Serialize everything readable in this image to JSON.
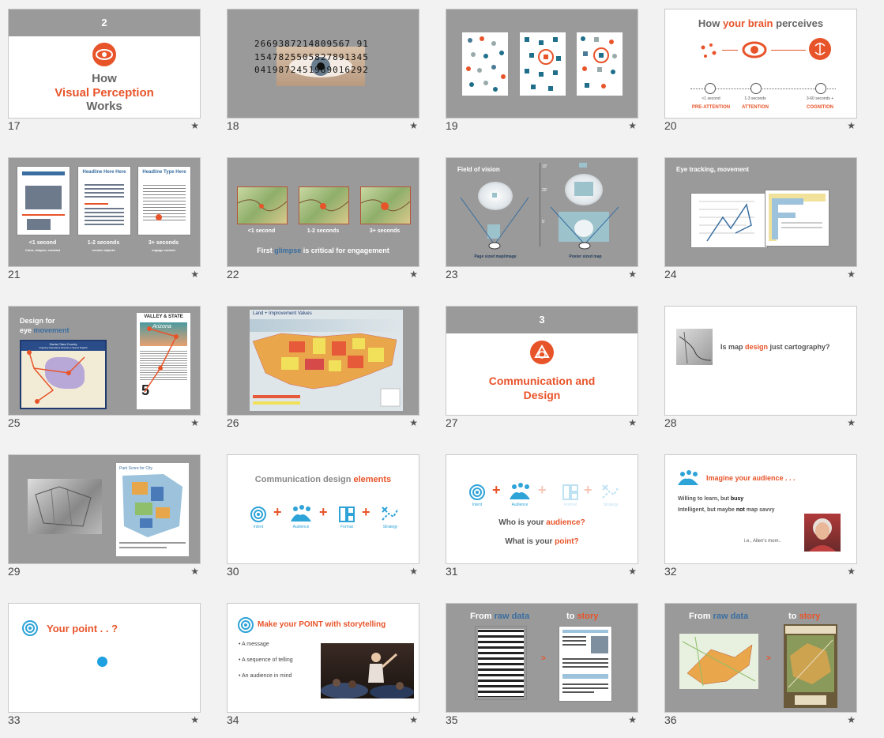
{
  "colors": {
    "accent": "#e8542a",
    "blue": "#2ea3d8",
    "grey": "#9a9a9a",
    "dark": "#555555"
  },
  "star": "★",
  "slides": {
    "s17": {
      "num": "17",
      "section": "2",
      "l1": "How",
      "l2": "Visual Perception",
      "l3": "Works"
    },
    "s18": {
      "num": "18",
      "r1": "2669387214809567 91",
      "r2": "1547825505827891345",
      "r3": "0419872451989016292"
    },
    "s19": {
      "num": "19"
    },
    "s20": {
      "num": "20",
      "t1": "How ",
      "t2": "your brain",
      "t3": " perceives",
      "a1": "<1 second",
      "a2": "1-3 seconds",
      "a3": "3-60 seconds +",
      "b1": "PRE-ATTENTION",
      "b2": "ATTENTION",
      "b3": "COGNITION"
    },
    "s21": {
      "num": "21",
      "h1": "Headline Here Here",
      "h2": "Headline Type Here",
      "c1": "<1 second",
      "c2": "1-2 seconds",
      "c3": "3+ seconds",
      "d1": "Color, shapes, contrast",
      "d2": "resolve objects",
      "d3": "engage content"
    },
    "s22": {
      "num": "22",
      "c1": "<1 second",
      "c2": "1-2 seconds",
      "c3": "3+ seconds",
      "m1": "First ",
      "m2": "glimpse",
      "m3": " is critical for engagement"
    },
    "s23": {
      "num": "23",
      "title": "Field of vision",
      "l1": "Page sized map/image",
      "l2": "Poster sized map",
      "d1": "10'",
      "d2": "20'",
      "d3": "5'"
    },
    "s24": {
      "num": "24",
      "title": "Eye tracking, movement"
    },
    "s25": {
      "num": "25",
      "t1": "Design for",
      "t2": "eye ",
      "t3": "movement",
      "m1": "Santa Clara County",
      "m2": "Ongoing Operations Directly to Spend English",
      "m3": "VALLEY & STATE",
      "m4": "Arizona",
      "big": "5"
    },
    "s26": {
      "num": "26",
      "title": "Land + Improvement Values"
    },
    "s27": {
      "num": "27",
      "section": "3",
      "l1": "Communication and",
      "l2": "Design"
    },
    "s28": {
      "num": "28",
      "t1": "Is map ",
      "t2": "design",
      "t3": " just cartography?"
    },
    "s29": {
      "num": "29",
      "title": "Park Score for City"
    },
    "s30": {
      "num": "30",
      "t1": "Communication design ",
      "t2": "elements",
      "plus": "+",
      "i1": "Intent",
      "i2": "Audience",
      "i3": "Format",
      "i4": "Strategy"
    },
    "s31": {
      "num": "31",
      "plus": "+",
      "i1": "Intent",
      "i2": "Audience",
      "i3": "Format",
      "i4": "Strategy",
      "q1a": "Who is your ",
      "q1b": "audience?",
      "q2a": "What is your ",
      "q2b": "point?"
    },
    "s32": {
      "num": "32",
      "title": "Imagine your audience . . .",
      "l1a": "Willing to learn, but ",
      "l1b": "busy",
      "l2a": "Intelligent, but maybe ",
      "l2b": "not",
      "l2c": " map savvy",
      "cap": "i.e., Allen's mom.."
    },
    "s33": {
      "num": "33",
      "title": "Your point . . ?"
    },
    "s34": {
      "num": "34",
      "title": "Make your POINT with storytelling",
      "b1": "A message",
      "b2": "A sequence of telling",
      "b3": "An audience in mind"
    },
    "s35": {
      "num": "35",
      "t1": "From ",
      "t2": "raw data",
      "t3": "to ",
      "t4": "story",
      "arrow": ">"
    },
    "s36": {
      "num": "36",
      "t1": "From ",
      "t2": "raw data",
      "t3": "to ",
      "t4": "story",
      "arrow": ">"
    }
  }
}
